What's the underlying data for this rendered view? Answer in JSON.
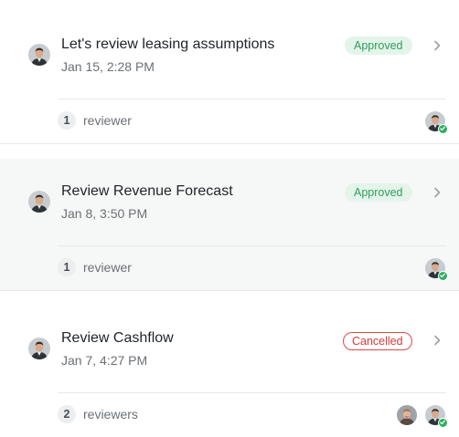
{
  "reviews": [
    {
      "title": "Let's review leasing assumptions",
      "date": "Jan 15, 2:28 PM",
      "status": "Approved",
      "reviewer_count": "1",
      "reviewer_label": "reviewer"
    },
    {
      "title": "Review Revenue Forecast",
      "date": "Jan 8, 3:50 PM",
      "status": "Approved",
      "reviewer_count": "1",
      "reviewer_label": "reviewer"
    },
    {
      "title": "Review Cashflow",
      "date": "Jan 7, 4:27 PM",
      "status": "Cancelled",
      "reviewer_count": "2",
      "reviewer_label": "reviewers"
    }
  ],
  "colors": {
    "approved_bg": "#e4f4ea",
    "approved_text": "#2f9e5c",
    "cancelled_border": "#e04848",
    "cancelled_text": "#d93a3a",
    "selected_row_bg": "#f6f8f7",
    "check_green": "#2bb060"
  },
  "icons": {
    "author_avatar": "person-avatar",
    "chevron": "chevron-right-icon",
    "approval_mark": "check-icon"
  }
}
